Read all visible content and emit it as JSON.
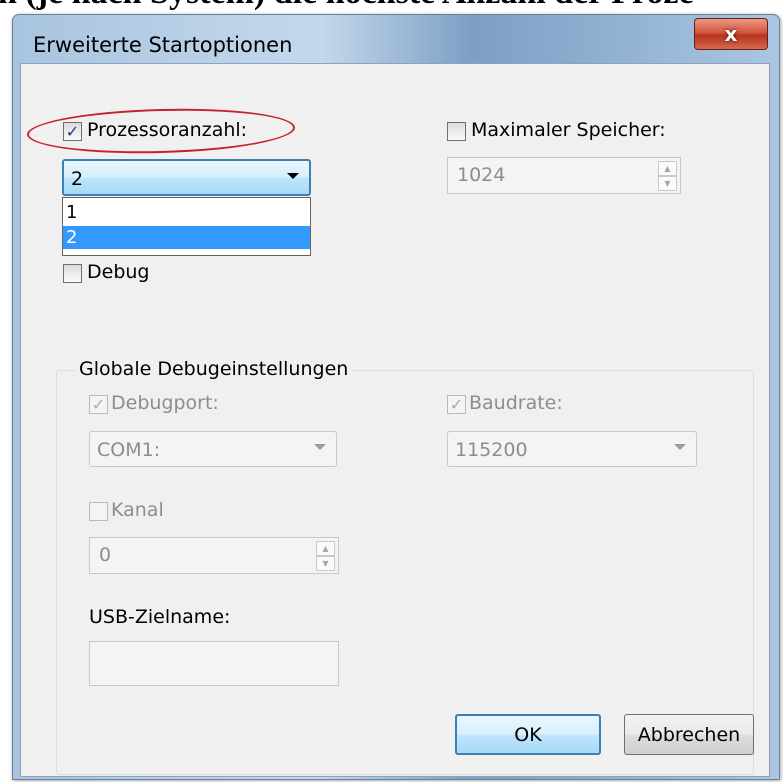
{
  "background_caption": "n (je nach System) die höchste Anzahl der Proze",
  "dialog": {
    "title": "Erweiterte Startoptionen",
    "close_glyph": "x",
    "processor_count": {
      "label": "Prozessoranzahl:",
      "checked": true,
      "selected": "2",
      "options": [
        "1",
        "2"
      ]
    },
    "max_memory": {
      "label": "Maximaler Speicher:",
      "checked": false,
      "value": "1024"
    },
    "debug": {
      "label": "Debug",
      "checked": false
    },
    "global_debug": {
      "group_title": "Globale Debugeinstellungen",
      "debugport": {
        "label": "Debugport:",
        "checked": true,
        "value": "COM1:"
      },
      "baudrate": {
        "label": "Baudrate:",
        "checked": true,
        "value": "115200"
      },
      "channel": {
        "label": "Kanal",
        "checked": false,
        "value": "0"
      },
      "usb_target": {
        "label": "USB-Zielname:",
        "value": ""
      }
    },
    "buttons": {
      "ok": "OK",
      "cancel": "Abbrechen"
    }
  },
  "colors": {
    "highlight_ellipse": "#c4222c",
    "selection": "#3399ff",
    "close_button": "#c9452c"
  }
}
